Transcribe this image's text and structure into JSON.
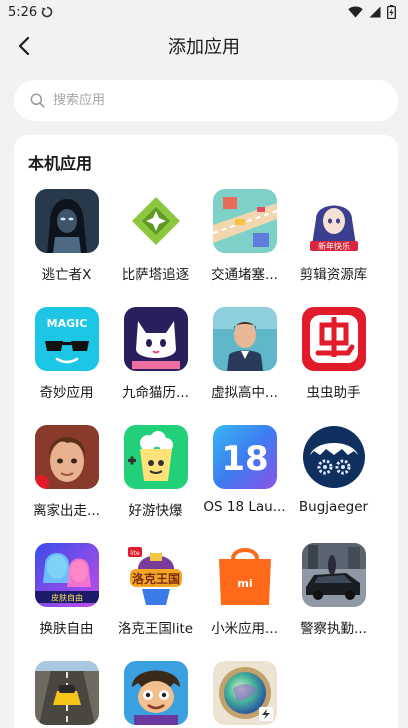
{
  "status": {
    "time": "5:26"
  },
  "header": {
    "title": "添加应用"
  },
  "search": {
    "placeholder": "搜索应用"
  },
  "section": {
    "title": "本机应用"
  },
  "apps": [
    {
      "label": "逃亡者X",
      "icon": "hooded-figure-icon"
    },
    {
      "label": "比萨塔追逐",
      "icon": "green-diamond-icon"
    },
    {
      "label": "交通堵塞...",
      "icon": "traffic-road-icon"
    },
    {
      "label": "剪辑资源库",
      "icon": "anime-girl-icon"
    },
    {
      "label": "奇妙应用",
      "icon": "magic-sunglasses-icon"
    },
    {
      "label": "九命猫历...",
      "icon": "white-cat-icon"
    },
    {
      "label": "虚拟高中...",
      "icon": "student-avatar-icon"
    },
    {
      "label": "虫虫助手",
      "icon": "chong-logo-icon"
    },
    {
      "label": "离家出走...",
      "icon": "boy-portrait-icon"
    },
    {
      "label": "好游快爆",
      "icon": "popcorn-gamepad-icon"
    },
    {
      "label": "OS 18 Lau...",
      "icon": "ios18-icon"
    },
    {
      "label": "Bugjaeger",
      "icon": "bug-gear-icon"
    },
    {
      "label": "换肤自由",
      "icon": "skin-girls-icon"
    },
    {
      "label": "洛克王国lite",
      "icon": "roco-kingdom-icon"
    },
    {
      "label": "小米应用...",
      "icon": "mi-store-bag-icon"
    },
    {
      "label": "警察执勤...",
      "icon": "police-car-icon"
    },
    {
      "label": "",
      "icon": "racing-car-icon"
    },
    {
      "label": "",
      "icon": "cartoon-character-icon"
    },
    {
      "label": "",
      "icon": "crystal-ball-icon"
    }
  ]
}
